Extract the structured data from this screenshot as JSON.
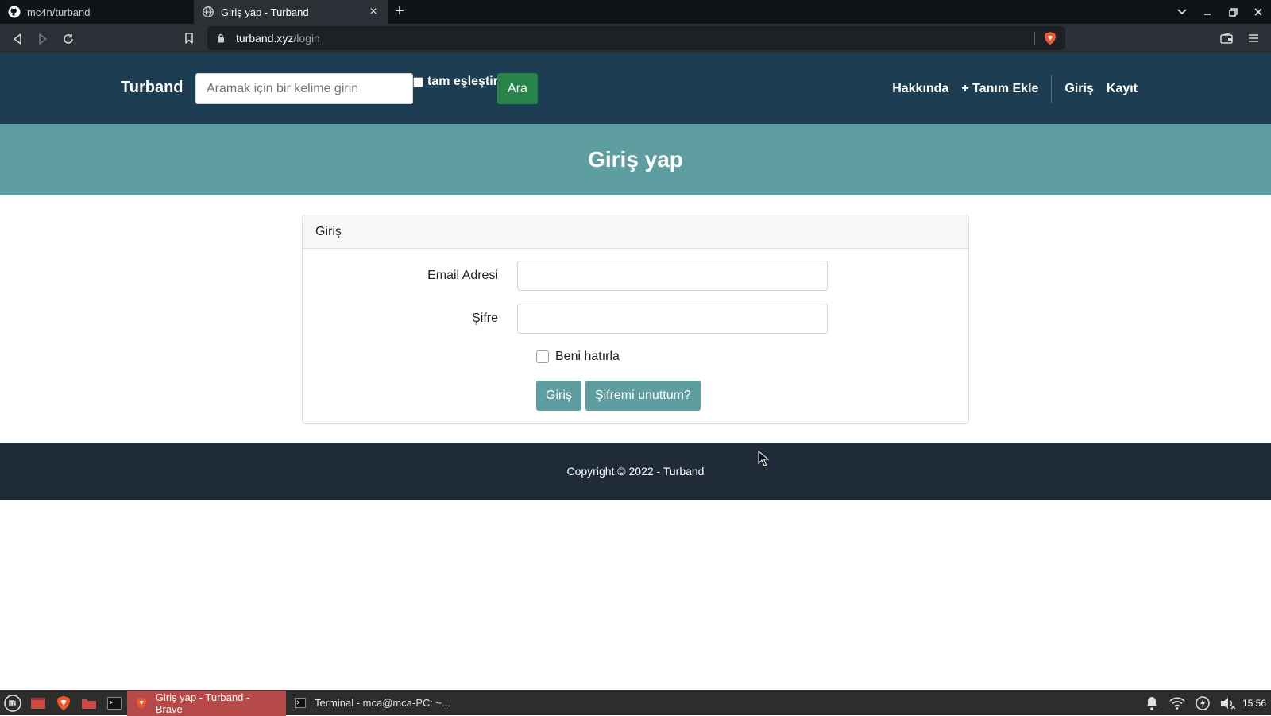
{
  "browser": {
    "tabs": [
      {
        "title": "mc4n/turband",
        "icon": "github-icon"
      },
      {
        "title": "Giriş yap - Turband",
        "icon": "globe-icon"
      }
    ],
    "url_host": "turband.xyz",
    "url_path": "/login"
  },
  "navbar": {
    "brand": "Turband",
    "search_placeholder": "Aramak için bir kelime girin",
    "search_value": "",
    "exact_match_label": "tam eşleştir",
    "search_button": "Ara",
    "links": {
      "about": "Hakkında",
      "add_definition": "+ Tanım Ekle",
      "login": "Giriş",
      "register": "Kayıt"
    }
  },
  "page": {
    "title": "Giriş yap"
  },
  "login_card": {
    "header": "Giriş",
    "email_label": "Email Adresi",
    "email_value": "",
    "password_label": "Şifre",
    "password_value": "",
    "remember_label": "Beni hatırla",
    "submit_button": "Giriş",
    "forgot_button": "Şifremi unuttum?"
  },
  "footer": {
    "text": "Copyright © 2022 - Turband"
  },
  "taskbar": {
    "tasks": [
      {
        "title": "Giriş yap - Turband - Brave",
        "active": true
      },
      {
        "title": "Terminal - mca@mca-PC: ~...",
        "active": false
      }
    ],
    "clock": "15:56"
  },
  "colors": {
    "navbar_bg": "#1c3d52",
    "header_bg": "#5f9ea0",
    "search_button_bg": "#28844a",
    "footer_bg": "#1f2b36"
  }
}
